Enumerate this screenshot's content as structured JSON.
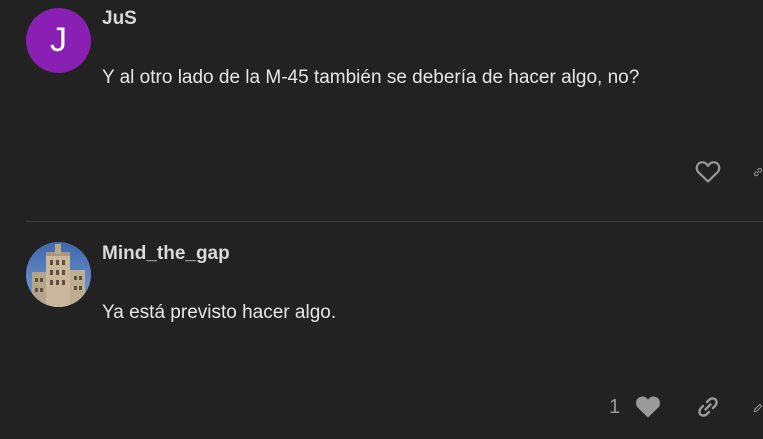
{
  "posts": [
    {
      "avatar_letter": "J",
      "avatar_color": "#8a1fb4",
      "username": "JuS",
      "body": "Y al otro lado de la M-45 también se debería de hacer algo, no?",
      "liked": false
    },
    {
      "username": "Mind_the_gap",
      "body": "Ya está previsto hacer algo.",
      "like_count": "1",
      "liked": true
    }
  ],
  "icons": {
    "like": "heart-icon",
    "share": "link-icon",
    "edit": "pencil-icon"
  },
  "colors": {
    "background": "#222222",
    "text": "#e6e6e6",
    "icon": "#9a9a9a",
    "divider": "#3a3a3a"
  }
}
